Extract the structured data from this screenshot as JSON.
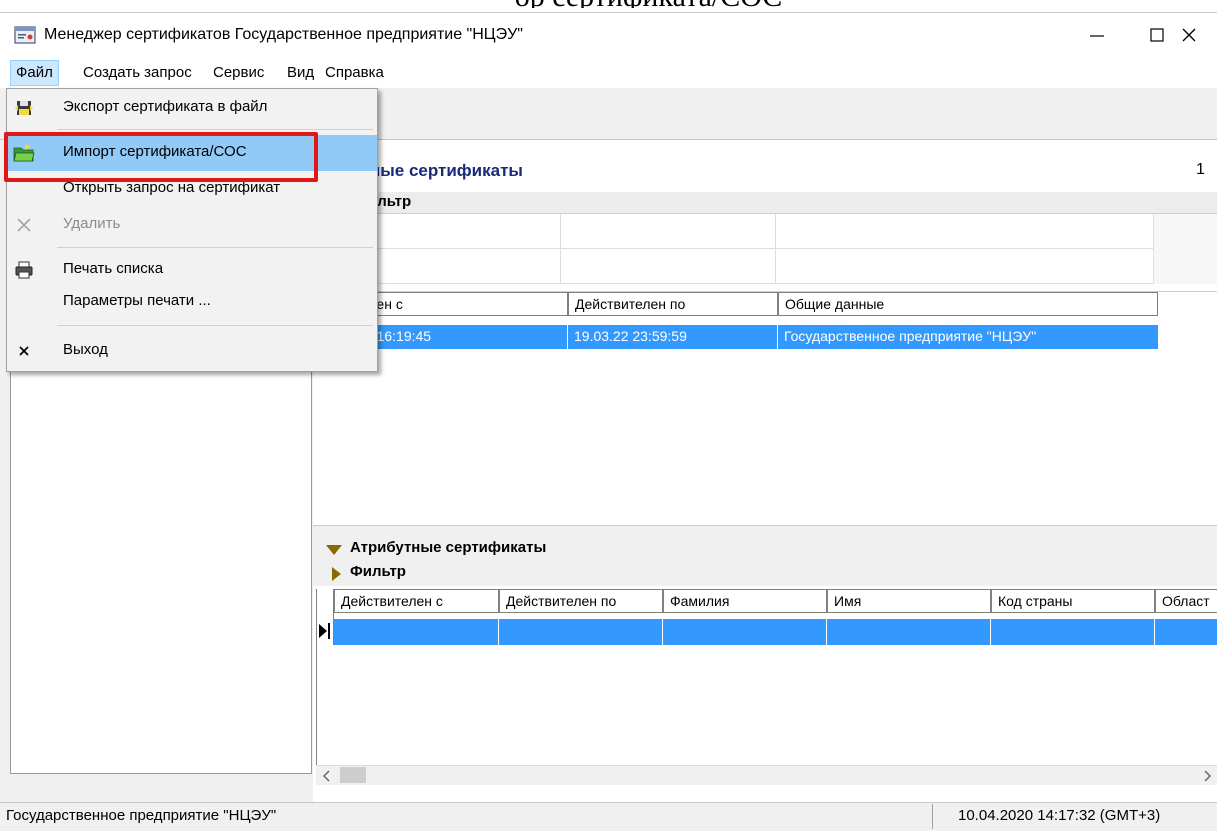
{
  "doc_fragment": "ор сертификата/СОС",
  "window": {
    "title": "Менеджер сертификатов  Государственное предприятие \"НЦЭУ\"",
    "minimize": "—",
    "maximize": "☐",
    "close": "✕"
  },
  "menubar": {
    "items": [
      "Файл",
      "Создать запрос",
      "Сервис",
      "Вид",
      "Справка"
    ],
    "active": "Файл"
  },
  "file_menu": {
    "items": [
      {
        "label": "Экспорт сертификата в файл",
        "icon": "export-disk-icon",
        "disabled": false
      },
      {
        "label": "Импорт сертификата/СОС",
        "icon": "import-folder-icon",
        "disabled": false,
        "highlighted": true
      },
      {
        "label": "Открыть запрос на сертификат",
        "icon": "",
        "disabled": false
      },
      {
        "label": "Удалить",
        "icon": "delete-x-icon",
        "disabled": true
      },
      {
        "label": "Печать списка",
        "icon": "printer-icon",
        "disabled": false
      },
      {
        "label": "Параметры печати ...",
        "icon": "",
        "disabled": false
      },
      {
        "label": "Выход",
        "icon": "close-x-icon",
        "disabled": false
      }
    ]
  },
  "main": {
    "section_title": "ные сертификаты",
    "section_count": "1",
    "filter_label": "ильтр",
    "grid1": {
      "columns": [
        "ствителен с",
        "Действителен по",
        "Общие данные"
      ],
      "rows": [
        [
          "0.03.20 16:19:45",
          "19.03.22 23:59:59",
          "Государственное предприятие \"НЦЭУ\""
        ]
      ]
    },
    "attr_section": {
      "title": "Атрибутные сертификаты",
      "filter_label": "Фильтр",
      "columns": [
        "Действителен с",
        "Действителен по",
        "Фамилия",
        "Имя",
        "Код страны",
        "Област"
      ]
    }
  },
  "statusbar": {
    "left": "Государственное предприятие \"НЦЭУ\"",
    "right": "10.04.2020 14:17:32 (GMT+3)"
  },
  "colors": {
    "selection": "#3399ff",
    "menu_highlight": "#91c9f7",
    "callout": "#e01818",
    "section_title": "#1a2a7a"
  }
}
